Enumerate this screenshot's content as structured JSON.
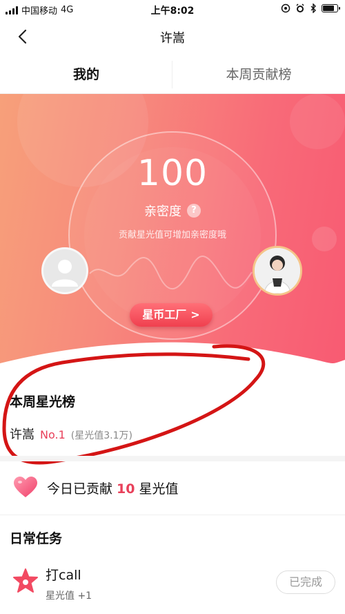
{
  "status_bar": {
    "carrier": "中国移动",
    "network": "4G",
    "time": "上午8:02",
    "battery_level": 0.85
  },
  "nav": {
    "title": "许嵩"
  },
  "tabs": [
    {
      "label": "我的",
      "active": true
    },
    {
      "label": "本周贡献榜",
      "active": false
    }
  ],
  "hero": {
    "score": "100",
    "intimacy_label": "亲密度",
    "help_symbol": "?",
    "hint": "贡献星光值可增加亲密度哦",
    "factory_label": "星币工厂",
    "factory_chevron": ">"
  },
  "weekly_rank": {
    "title": "本周星光榜",
    "name": "许嵩",
    "rank": "No.1",
    "value": "(星光值3.1万)"
  },
  "today": {
    "prefix": "今日已贡献",
    "count": "10",
    "suffix": "星光值"
  },
  "tasks": {
    "title": "日常任务",
    "items": [
      {
        "name": "打call",
        "reward": "星光值 +1",
        "status": "已完成"
      }
    ]
  },
  "colors": {
    "accent": "#e8405a",
    "hero_start": "#f7a07a",
    "hero_end": "#f85a72",
    "annotation": "#d41515"
  },
  "icons": [
    "back-icon",
    "help-icon",
    "heart-icon",
    "star-icon",
    "alarm-icon",
    "bluetooth-icon",
    "battery-icon"
  ]
}
